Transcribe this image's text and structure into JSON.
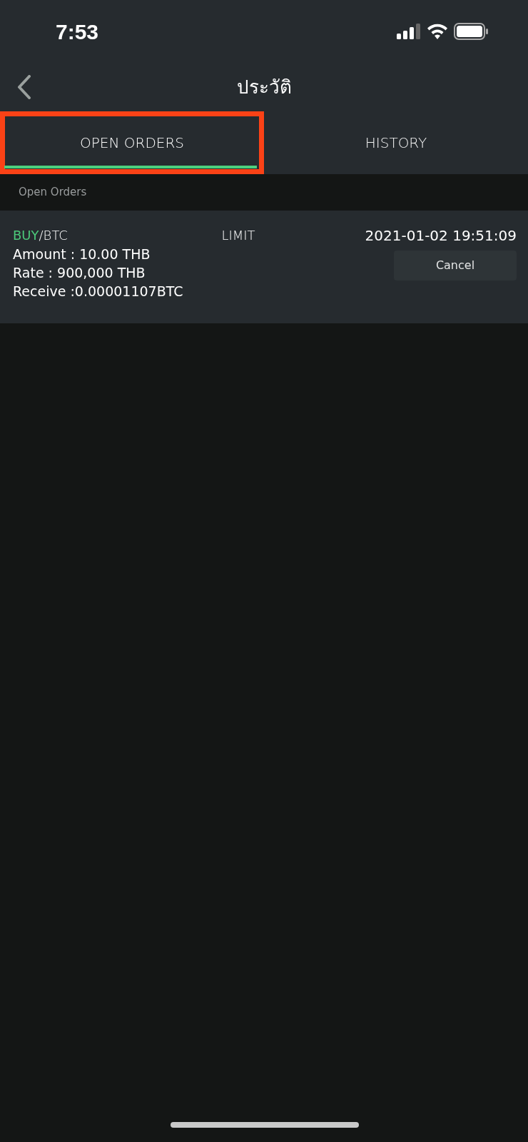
{
  "status_bar": {
    "time": "7:53"
  },
  "header": {
    "title": "ประวัติ"
  },
  "tabs": [
    {
      "label": "OPEN ORDERS",
      "selected": true,
      "highlighted": true
    },
    {
      "label": "HISTORY",
      "selected": false,
      "highlighted": false
    }
  ],
  "section_label": "Open Orders",
  "orders": [
    {
      "kind": "buy",
      "side": "BUY",
      "pair": "/BTC",
      "type": "LIMIT",
      "datetime": "2021-01-02 19:51:09",
      "lines": [
        "Amount : 10.00 THB",
        "Rate : 900,000 THB",
        "Receive :0.00001107BTC"
      ],
      "action": "Cancel"
    }
  ]
}
